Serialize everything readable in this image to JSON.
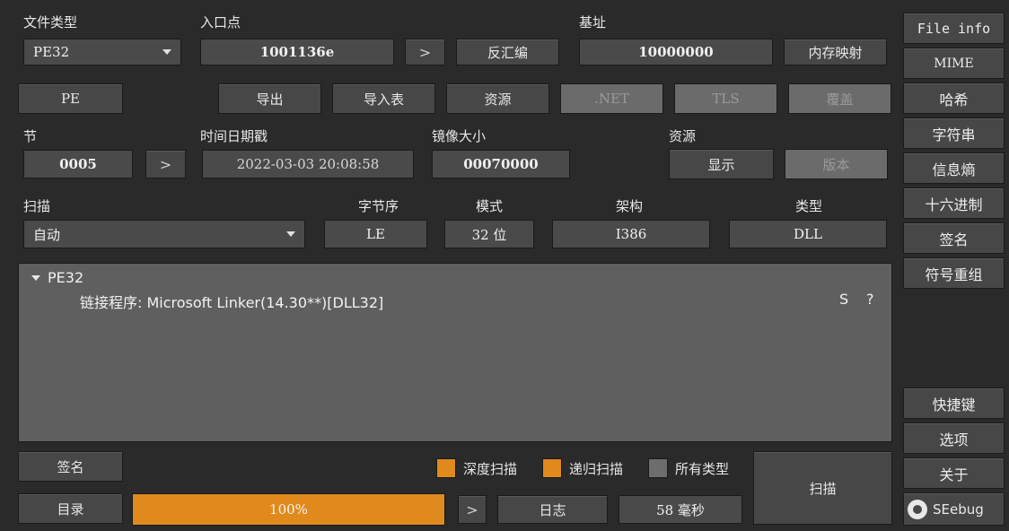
{
  "top": {
    "file_type_label": "文件类型",
    "file_type_value": "PE32",
    "entry_label": "入口点",
    "entry_value": "1001136e",
    "disasm_button": "反汇编",
    "base_label": "基址",
    "base_value": "10000000",
    "memmap_button": "内存映射",
    "pe_button": "PE",
    "export_button": "导出",
    "import_button": "导入表",
    "resource_button": "资源",
    "net_button": ".NET",
    "tls_button": "TLS",
    "overlay_button": "覆盖"
  },
  "section": {
    "section_label": "节",
    "section_value": "0005",
    "timestamp_label": "时间日期戳",
    "timestamp_value": "2022-03-03 20:08:58",
    "image_size_label": "镜像大小",
    "image_size_value": "00070000",
    "resources_label": "资源",
    "show_button": "显示",
    "version_button": "版本"
  },
  "scan": {
    "scan_label": "扫描",
    "scan_mode_value": "自动",
    "endian_label": "字节序",
    "endian_value": "LE",
    "mode_label": "模式",
    "mode_value": "32 位",
    "arch_label": "架构",
    "arch_value": "I386",
    "type_label": "类型",
    "type_value": "DLL"
  },
  "result": {
    "root": "PE32",
    "linker_line": "链接程序: Microsoft Linker(14.30**)[DLL32]",
    "s_label": "S",
    "q_label": "?"
  },
  "bottom": {
    "signature_button": "签名",
    "directory_button": "目录",
    "deep_scan_label": "深度扫描",
    "deep_scan_checked": true,
    "recursive_scan_label": "递归扫描",
    "recursive_scan_checked": true,
    "all_types_label": "所有类型",
    "all_types_checked": false,
    "progress_text": "100%",
    "progress_value": 1.0,
    "log_button": "日志",
    "elapsed": "58 毫秒",
    "scan_button": "扫描"
  },
  "sidebar": {
    "items": [
      "File info",
      "MIME",
      "哈希",
      "字符串",
      "信息熵",
      "十六进制",
      "签名",
      "符号重组"
    ],
    "lower_items": [
      "快捷键",
      "选项",
      "关于"
    ],
    "watermark": "SEebug"
  },
  "colors": {
    "accent": "#e08a1e",
    "background": "#2a2a2a",
    "panel": "#5f5f5f"
  }
}
